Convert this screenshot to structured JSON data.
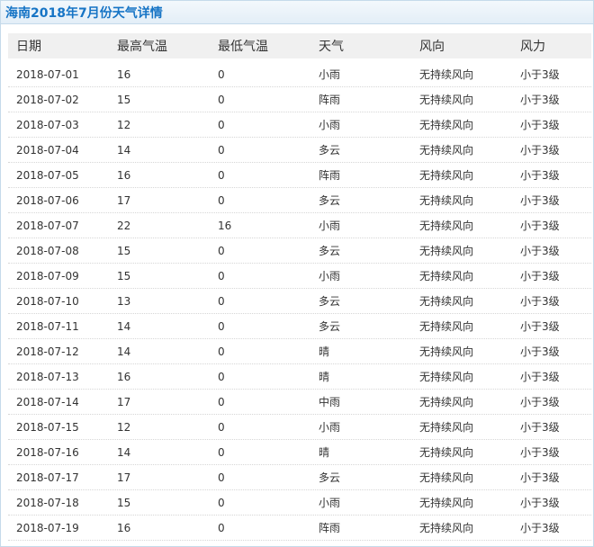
{
  "title": "海南2018年7月份天气详情",
  "columns": [
    "日期",
    "最高气温",
    "最低气温",
    "天气",
    "风向",
    "风力"
  ],
  "rows": [
    [
      "2018-07-01",
      "16",
      "0",
      "小雨",
      "无持续风向",
      "小于3级"
    ],
    [
      "2018-07-02",
      "15",
      "0",
      "阵雨",
      "无持续风向",
      "小于3级"
    ],
    [
      "2018-07-03",
      "12",
      "0",
      "小雨",
      "无持续风向",
      "小于3级"
    ],
    [
      "2018-07-04",
      "14",
      "0",
      "多云",
      "无持续风向",
      "小于3级"
    ],
    [
      "2018-07-05",
      "16",
      "0",
      "阵雨",
      "无持续风向",
      "小于3级"
    ],
    [
      "2018-07-06",
      "17",
      "0",
      "多云",
      "无持续风向",
      "小于3级"
    ],
    [
      "2018-07-07",
      "22",
      "16",
      "小雨",
      "无持续风向",
      "小于3级"
    ],
    [
      "2018-07-08",
      "15",
      "0",
      "多云",
      "无持续风向",
      "小于3级"
    ],
    [
      "2018-07-09",
      "15",
      "0",
      "小雨",
      "无持续风向",
      "小于3级"
    ],
    [
      "2018-07-10",
      "13",
      "0",
      "多云",
      "无持续风向",
      "小于3级"
    ],
    [
      "2018-07-11",
      "14",
      "0",
      "多云",
      "无持续风向",
      "小于3级"
    ],
    [
      "2018-07-12",
      "14",
      "0",
      "晴",
      "无持续风向",
      "小于3级"
    ],
    [
      "2018-07-13",
      "16",
      "0",
      "晴",
      "无持续风向",
      "小于3级"
    ],
    [
      "2018-07-14",
      "17",
      "0",
      "中雨",
      "无持续风向",
      "小于3级"
    ],
    [
      "2018-07-15",
      "12",
      "0",
      "小雨",
      "无持续风向",
      "小于3级"
    ],
    [
      "2018-07-16",
      "14",
      "0",
      "晴",
      "无持续风向",
      "小于3级"
    ],
    [
      "2018-07-17",
      "17",
      "0",
      "多云",
      "无持续风向",
      "小于3级"
    ],
    [
      "2018-07-18",
      "15",
      "0",
      "小雨",
      "无持续风向",
      "小于3级"
    ],
    [
      "2018-07-19",
      "16",
      "0",
      "阵雨",
      "无持续风向",
      "小于3级"
    ]
  ],
  "colors": {
    "title_text": "#1674c5",
    "title_bar_bg": "#e3eef7",
    "border": "#c5daea",
    "header_bg": "#f0f0f0",
    "text": "#333333"
  }
}
